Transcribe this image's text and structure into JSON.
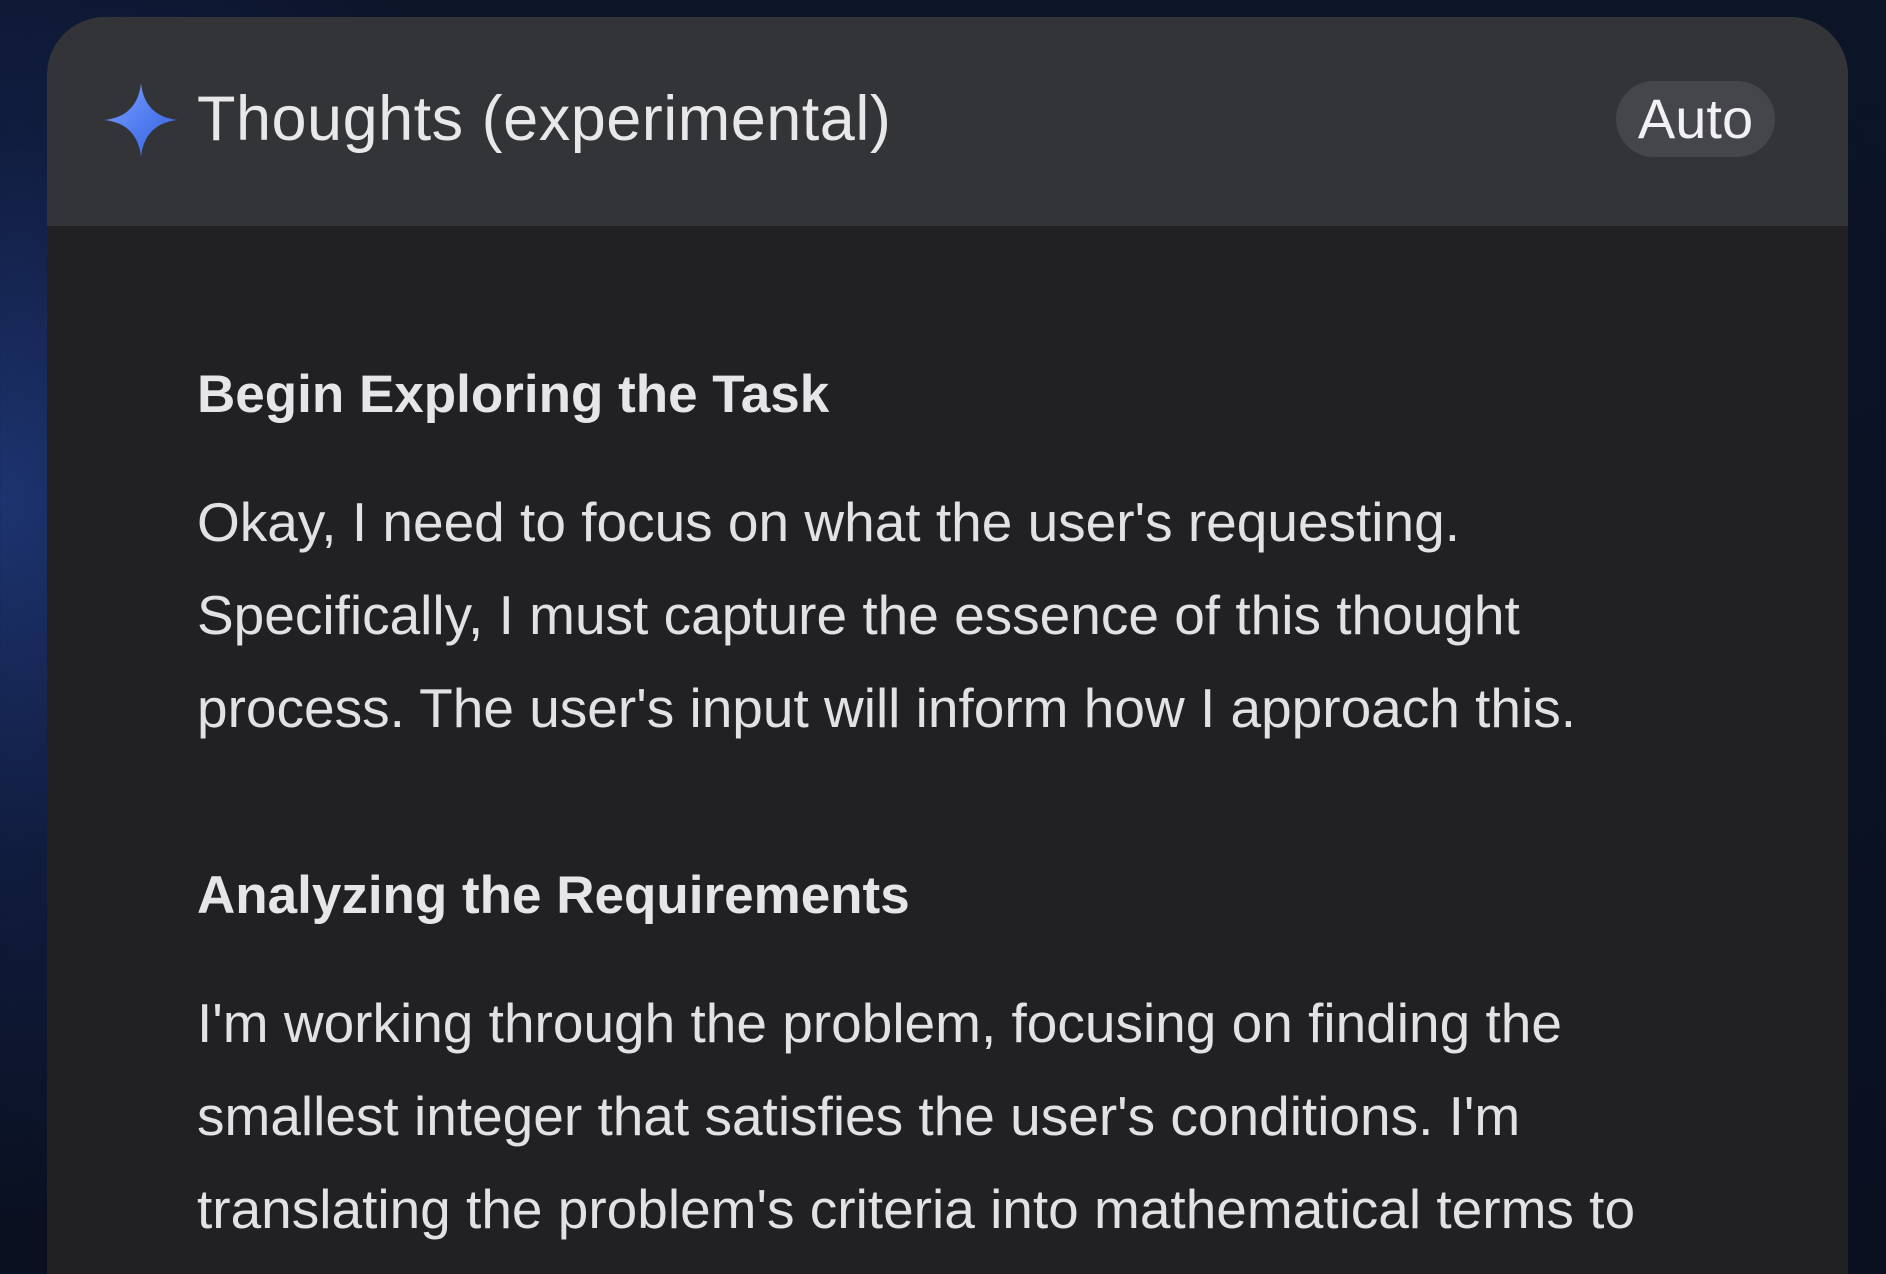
{
  "panel": {
    "title": "Thoughts (experimental)",
    "mode_chip": "Auto",
    "icon": "sparkle-icon"
  },
  "thoughts": [
    {
      "heading": "Begin Exploring the Task",
      "lines": [
        "Okay, I need to focus on what the user's requesting.",
        "Specifically, I must capture the essence of this thought",
        "process. The user's input will inform how I approach this."
      ]
    },
    {
      "heading": "Analyzing the Requirements",
      "lines": [
        "I'm working through the problem, focusing on finding the",
        "smallest integer that satisfies the user's conditions. I'm",
        "translating the problem's criteria into mathematical terms to"
      ]
    }
  ],
  "colors": {
    "panel_background": "#212124",
    "header_background": "#333438",
    "chip_background": "#45464b",
    "text": "#e2e2e4",
    "sparkle_gradient": [
      "#4f7bf0",
      "#8aa8ff"
    ]
  }
}
